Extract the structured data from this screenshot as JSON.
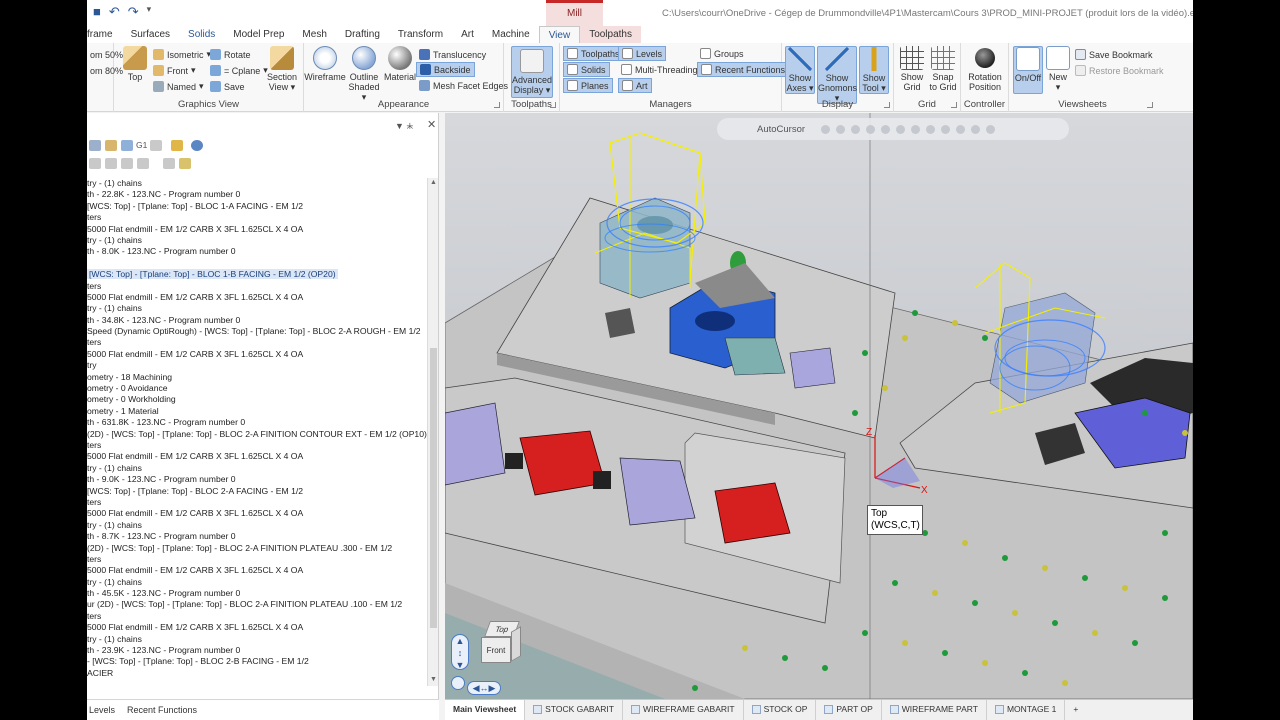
{
  "titlebar": {
    "path": "C:\\Users\\courr\\OneDrive - Cégep de Drummondville\\4P1\\Mastercam\\Cours 3\\PROD_MINI-PROJET (produit lors de la vidéo).emcam* - Mastercam M",
    "context_group": "Mill"
  },
  "tabs": [
    "frame",
    "Surfaces",
    "Solids",
    "Model Prep",
    "Mesh",
    "Drafting",
    "Transform",
    "Art",
    "Machine",
    "View",
    "Toolpaths"
  ],
  "ribbon": {
    "zoom": {
      "in": "om 50%",
      "out": "om 80%"
    },
    "graphics_view": {
      "label": "Graphics View",
      "top": "Top",
      "isometric": "Isometric",
      "front": "Front",
      "named": "Named",
      "rotate": "Rotate",
      "cplane": "= Cplane",
      "save": "Save",
      "section_view": [
        "Section",
        "View"
      ]
    },
    "appearance": {
      "label": "Appearance",
      "wireframe": "Wireframe",
      "outline_shaded": [
        "Outline",
        "Shaded"
      ],
      "material": "Material",
      "translucency": "Translucency",
      "backside": "Backside",
      "mesh_facet_edges": "Mesh Facet Edges"
    },
    "toolpaths": {
      "label": "Toolpaths",
      "advanced_display": [
        "Advanced",
        "Display"
      ]
    },
    "managers": {
      "label": "Managers",
      "toolpaths": "Toolpaths",
      "solids": "Solids",
      "planes": "Planes",
      "levels": "Levels",
      "multithreading": "Multi-Threading",
      "art": "Art",
      "groups": "Groups",
      "recent_functions": "Recent Functions"
    },
    "display": {
      "label": "Display",
      "show_axes": [
        "Show",
        "Axes"
      ],
      "show_gnomons": [
        "Show",
        "Gnomons"
      ],
      "show_tool": [
        "Show",
        "Tool"
      ]
    },
    "grid": {
      "label": "Grid",
      "show_grid": [
        "Show",
        "Grid"
      ],
      "snap_to_grid": [
        "Snap",
        "to Grid"
      ]
    },
    "controller": {
      "label": "Controller",
      "rotation_position": [
        "Rotation",
        "Position"
      ]
    },
    "viewsheets": {
      "label": "Viewsheets",
      "onoff": "On/Off",
      "new": "New",
      "save_bookmark": "Save Bookmark",
      "restore_bookmark": "Restore Bookmark"
    }
  },
  "panel": {
    "toolbar_g1": "G1",
    "operations": [
      "try - (1) chains",
      "th - 22.8K - 123.NC - Program number 0",
      "[WCS: Top] - [Tplane: Top] - BLOC 1-A FACING - EM 1/2",
      "ters",
      "5000 Flat endmill - EM 1/2 CARB X 3FL 1.625CL X 4 OA",
      "try - (1) chains",
      "th - 8.0K - 123.NC - Program number 0",
      "",
      "[WCS: Top] - [Tplane: Top] - BLOC 1-B FACING - EM 1/2 (OP20)",
      "ters",
      "5000 Flat endmill - EM 1/2 CARB X 3FL 1.625CL X 4 OA",
      "try - (1) chains",
      "th - 34.8K - 123.NC - Program number 0",
      "Speed (Dynamic OptiRough) - [WCS: Top] - [Tplane: Top] - BLOC 2-A ROUGH - EM 1/2",
      "ters",
      "5000 Flat endmill - EM 1/2 CARB X 3FL 1.625CL X 4 OA",
      "try",
      "ometry - 18 Machining",
      "ometry - 0 Avoidance",
      "ometry - 0 Workholding",
      "ometry - 1 Material",
      "th - 631.8K - 123.NC - Program number 0",
      "(2D) - [WCS: Top] - [Tplane: Top] - BLOC 2-A FINITION CONTOUR EXT - EM 1/2  (OP10)",
      "ters",
      "5000 Flat endmill - EM 1/2 CARB X 3FL 1.625CL X 4 OA",
      "try - (1) chains",
      "th - 9.0K - 123.NC - Program number 0",
      "[WCS: Top] - [Tplane: Top] - BLOC 2-A FACING - EM 1/2",
      "ters",
      "5000 Flat endmill - EM 1/2 CARB X 3FL 1.625CL X 4 OA",
      "try - (1) chains",
      "th - 8.7K - 123.NC - Program number 0",
      "(2D) - [WCS: Top] - [Tplane: Top] - BLOC 2-A FINITION PLATEAU .300 - EM 1/2",
      "ters",
      "5000 Flat endmill - EM 1/2 CARB X 3FL 1.625CL X 4 OA",
      "try - (1) chains",
      "th - 45.5K - 123.NC - Program number 0",
      "ur (2D) - [WCS: Top] - [Tplane: Top] - BLOC 2-A FINITION PLATEAU .100 - EM 1/2",
      "ters",
      "5000 Flat endmill - EM 1/2 CARB X 3FL 1.625CL X 4 OA",
      "try - (1) chains",
      "th - 23.9K - 123.NC - Program number 0",
      "- [WCS: Top] - [Tplane: Top] - BLOC 2-B FACING - EM 1/2",
      "ACIER"
    ],
    "selected_index": 8,
    "bottom_tabs": [
      "Levels",
      "Recent Functions"
    ]
  },
  "viewport": {
    "autocursor": "AutoCursor",
    "tooltip": [
      "Top",
      "(WCS,C,T)"
    ],
    "axis_z": "Z",
    "axis_x": "X",
    "viewcube": {
      "top": "Top",
      "front": "Front"
    }
  },
  "viewsheets": [
    "Main Viewsheet",
    "STOCK GABARIT",
    "WIREFRAME GABARIT",
    "STOCK OP",
    "PART OP",
    "WIREFRAME PART",
    "MONTAGE 1",
    "+"
  ],
  "colors": {
    "accent": "#2b5797",
    "viewport_bg": "#c9ccd1",
    "plate": "#c2c2c2",
    "red_vise": "#d61f1f",
    "blue_vise": "#2a5fd0",
    "toolpath_yellow": "#f5f000",
    "toolpath_blue": "#3a80ff"
  }
}
